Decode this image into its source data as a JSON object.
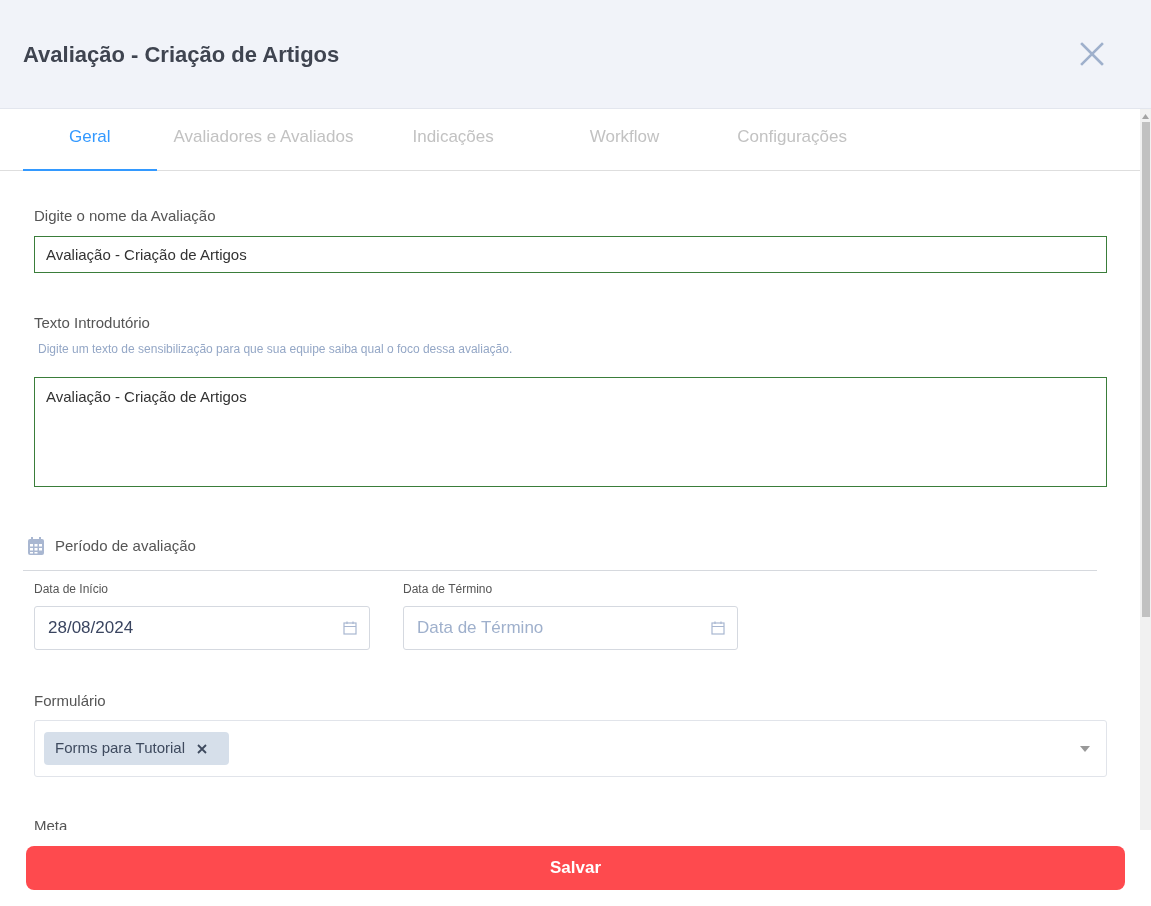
{
  "dialog": {
    "title": "Avaliação - Criação de Artigos"
  },
  "tabs": [
    {
      "label": "Geral",
      "selected": true
    },
    {
      "label": "Avaliadores e Avaliados",
      "selected": false
    },
    {
      "label": "Indicações",
      "selected": false
    },
    {
      "label": "Workflow",
      "selected": false
    },
    {
      "label": "Configurações",
      "selected": false
    }
  ],
  "name_field": {
    "label": "Digite o nome da Avaliação",
    "value": "Avaliação - Criação de Artigos"
  },
  "intro_field": {
    "label": "Texto Introdutório",
    "hint": "Digite um texto de sensibilização para que sua equipe saiba qual o foco dessa avaliação.",
    "value": "Avaliação - Criação de Artigos"
  },
  "period": {
    "title": "Período de avaliação",
    "start": {
      "label": "Data de Início",
      "value": "28/08/2024"
    },
    "end": {
      "label": "Data de Término",
      "placeholder": "Data de Término"
    }
  },
  "form_select": {
    "label": "Formulário",
    "tags": [
      "Forms para Tutorial"
    ]
  },
  "goal": {
    "label": "Meta"
  },
  "save_button": "Salvar"
}
